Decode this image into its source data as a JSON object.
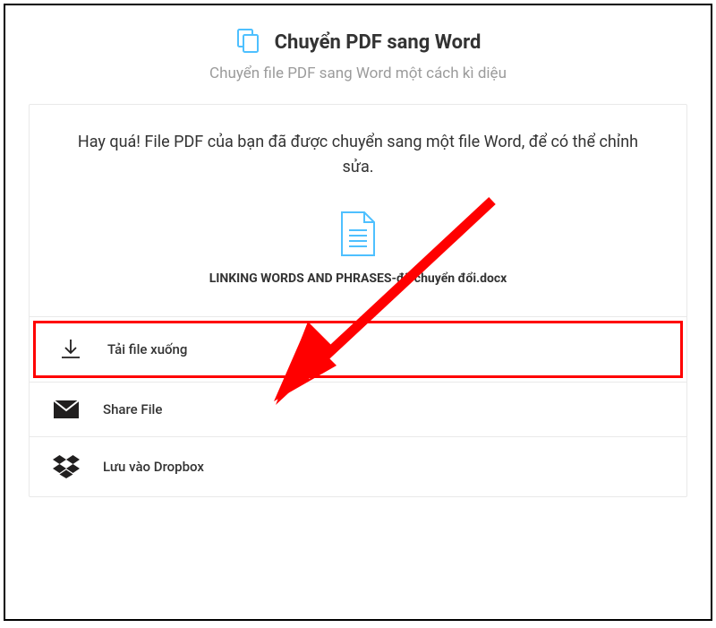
{
  "header": {
    "title": "Chuyển PDF sang Word",
    "subtitle": "Chuyển file PDF sang Word một cách kì diệu"
  },
  "success": {
    "message": "Hay quá! File PDF của bạn đã được chuyển sang một file Word, để có thể chỉnh sửa.",
    "filename": "LINKING WORDS AND PHRASES-đã chuyển đổi.docx"
  },
  "actions": {
    "download_label": "Tải file xuống",
    "share_label": "Share File",
    "dropbox_label": "Lưu vào Dropbox"
  },
  "colors": {
    "accent": "#4ec0ff",
    "highlight": "#ff0000"
  }
}
